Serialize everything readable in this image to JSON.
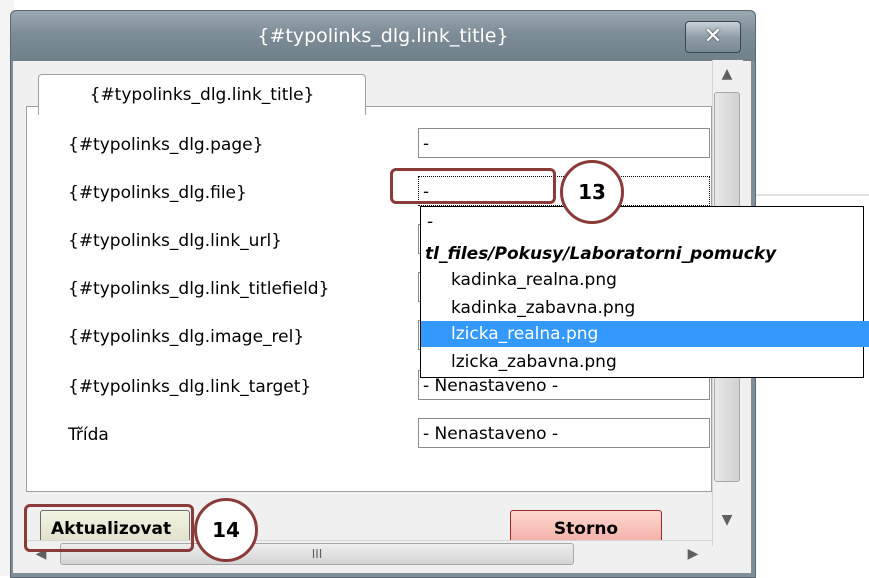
{
  "dialog": {
    "title": "{#typolinks_dlg.link_title}",
    "close_label": "✕",
    "tab_label": "{#typolinks_dlg.link_title}"
  },
  "form": {
    "rows": [
      {
        "label": "{#typolinks_dlg.page}",
        "value": "-"
      },
      {
        "label": "{#typolinks_dlg.file}",
        "value": "-"
      },
      {
        "label": "{#typolinks_dlg.link_url}",
        "value": ""
      },
      {
        "label": "{#typolinks_dlg.link_titlefield}",
        "value": ""
      },
      {
        "label": "{#typolinks_dlg.image_rel}",
        "value": ""
      },
      {
        "label": "{#typolinks_dlg.link_target}",
        "value": "- Nenastaveno -"
      },
      {
        "label": "Třída",
        "value": "- Nenastaveno -"
      }
    ]
  },
  "dropdown": {
    "options": [
      {
        "label": "-"
      },
      {
        "label": "tl_files/Pokusy/Laboratorni_pomucky"
      },
      {
        "label": "kadinka_realna.png"
      },
      {
        "label": "kadinka_zabavna.png"
      },
      {
        "label": "lzicka_realna.png"
      },
      {
        "label": "lzicka_zabavna.png"
      }
    ]
  },
  "buttons": {
    "update": "Aktualizovat",
    "cancel": "Storno"
  },
  "scrollbar": {
    "up_arrow": "▲",
    "down_arrow": "▼",
    "left_arrow": "◀",
    "right_arrow": "▶",
    "grip": "III"
  },
  "callouts": {
    "first": "13",
    "second": "14"
  },
  "colors": {
    "selection": "#3399ff",
    "callout": "#8b3a3a"
  }
}
